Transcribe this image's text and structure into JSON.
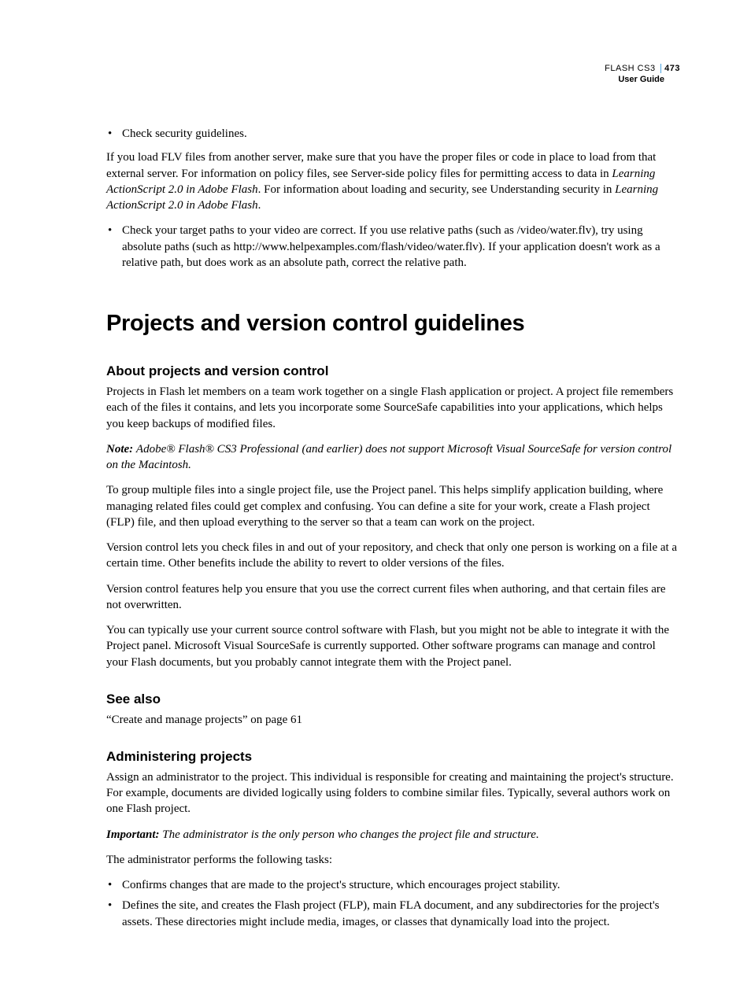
{
  "header": {
    "product": "FLASH CS3",
    "pagenum": "473",
    "subtitle": "User Guide"
  },
  "top_bullet_1": "Check security guidelines.",
  "top_para_1a": "If you load FLV files from another server, make sure that you have the proper files or code in place to load from that external server. For information on policy files, see Server-side policy files for permitting access to data in ",
  "top_para_1_em1": "Learning ActionScript 2.0 in Adobe Flash",
  "top_para_1b": ". For information about loading and security, see Understanding security in ",
  "top_para_1_em2": "Learning ActionScript 2.0 in Adobe Flash",
  "top_para_1c": ".",
  "top_bullet_2": "Check your target paths to your video are correct. If you use relative paths (such as /video/water.flv), try using absolute paths (such as http://www.helpexamples.com/flash/video/water.flv). If your application doesn't work as a relative path, but does work as an absolute path, correct the relative path.",
  "h1": "Projects and version control guidelines",
  "h2_about": "About projects and version control",
  "about_p1": "Projects in Flash let members on a team work together on a single Flash application or project. A project file remembers each of the files it contains, and lets you incorporate some SourceSafe capabilities into your applications, which helps you keep backups of modified files.",
  "note_label": "Note:",
  "note_text": "Adobe® Flash® CS3 Professional (and earlier) does not support Microsoft Visual SourceSafe for version control on the Macintosh.",
  "about_p2": "To group multiple files into a single project file, use the Project panel. This helps simplify application building, where managing related files could get complex and confusing. You can define a site for your work, create a Flash project (FLP) file, and then upload everything to the server so that a team can work on the project.",
  "about_p3": "Version control lets you check files in and out of your repository, and check that only one person is working on a file at a certain time. Other benefits include the ability to revert to older versions of the files.",
  "about_p4": "Version control features help you ensure that you use the correct current files when authoring, and that certain files are not overwritten.",
  "about_p5": "You can typically use your current source control software with Flash, but you might not be able to integrate it with the Project panel. Microsoft Visual SourceSafe is currently supported. Other software programs can manage and control your Flash documents, but you probably cannot integrate them with the Project panel.",
  "h2_seealso": "See also",
  "seealso_link": "“Create and manage projects” on page 61",
  "h2_admin": "Administering projects",
  "admin_p1": "Assign an administrator to the project. This individual is responsible for creating and maintaining the project's structure. For example, documents are divided logically using folders to combine similar files. Typically, several authors work on one Flash project.",
  "imp_label": "Important:",
  "imp_text": "The administrator is the only person who changes the project file and structure.",
  "admin_p2": "The administrator performs the following tasks:",
  "admin_bullet_1": "Confirms changes that are made to the project's structure, which encourages project stability.",
  "admin_bullet_2": "Defines the site, and creates the Flash project (FLP), main FLA document, and any subdirectories for the project's assets. These directories might include media, images, or classes that dynamically load into the project."
}
